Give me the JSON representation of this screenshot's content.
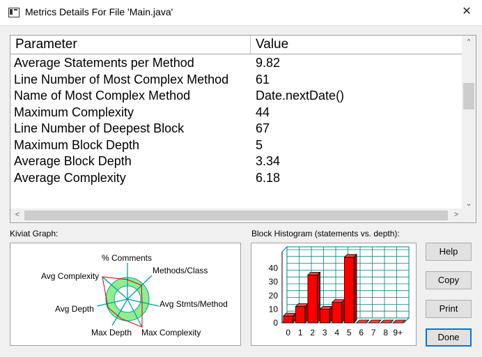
{
  "window": {
    "title": "Metrics Details For File 'Main.java'",
    "close_glyph": "✕"
  },
  "table": {
    "headers": {
      "parameter": "Parameter",
      "value": "Value"
    },
    "rows": [
      {
        "parameter": "Average Statements per Method",
        "value": "9.82"
      },
      {
        "parameter": "Line Number of Most Complex Method",
        "value": "61"
      },
      {
        "parameter": "Name of Most Complex Method",
        "value": "Date.nextDate()"
      },
      {
        "parameter": "Maximum Complexity",
        "value": "44"
      },
      {
        "parameter": "Line Number of Deepest Block",
        "value": "67"
      },
      {
        "parameter": "Maximum Block Depth",
        "value": "5"
      },
      {
        "parameter": "Average Block Depth",
        "value": "3.34"
      },
      {
        "parameter": "Average Complexity",
        "value": "6.18"
      }
    ]
  },
  "kiviat": {
    "label": "Kiviat Graph:",
    "axes": [
      "% Comments",
      "Methods/Class",
      "Avg Stmts/Method",
      "Max Complexity",
      "Max Depth",
      "Avg Depth",
      "Avg Complexity"
    ]
  },
  "histogram": {
    "label": "Block Histogram (statements vs. depth):",
    "y_ticks": [
      "40",
      "30",
      "20",
      "10",
      "0"
    ],
    "x_labels": [
      "0",
      "1",
      "2",
      "3",
      "4",
      "5",
      "6",
      "7",
      "8",
      "9+"
    ]
  },
  "chart_data": {
    "type": "bar",
    "categories": [
      "0",
      "1",
      "2",
      "3",
      "4",
      "5",
      "6",
      "7",
      "8",
      "9+"
    ],
    "values": [
      5,
      12,
      35,
      10,
      15,
      48,
      0,
      0,
      0,
      0
    ],
    "xlabel": "",
    "ylabel": "",
    "ylim": [
      0,
      50
    ],
    "grid": true,
    "bar_color": "#ff0000"
  },
  "buttons": {
    "help": "Help",
    "copy": "Copy",
    "print": "Print",
    "done": "Done"
  },
  "colors": {
    "accent": "#0078d7",
    "bar": "#ff0000",
    "kiviat_ring": "#90ee90",
    "kiviat_axis": "#00a0a0"
  }
}
